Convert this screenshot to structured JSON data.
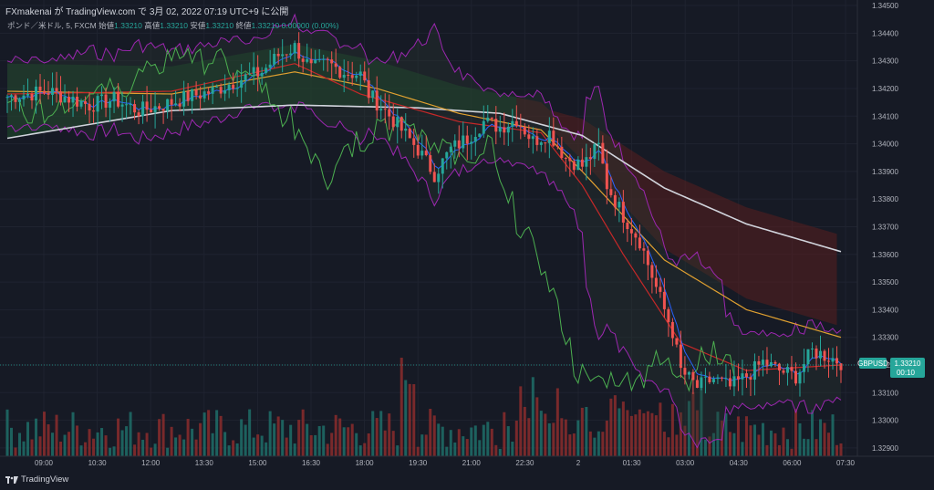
{
  "header": {
    "text": "FXmakenai が TradingView.com で 3月 02, 2022 07:19 UTC+9 に公開"
  },
  "legend": {
    "symbol": "ポンド／米ドル, 5, FXCM",
    "open_label": "始値",
    "open_value": "1.33210",
    "high_label": "高値",
    "high_value": "1.33210",
    "low_label": "安値",
    "low_value": "1.33210",
    "close_label": "終値",
    "close_value": "1.33210",
    "change": "0.00000 (0.00%)"
  },
  "brand": {
    "text": "TradingView",
    "logo": "tradingview-logo"
  },
  "price_tag": {
    "label": "GBPUSD",
    "price": "1.33210",
    "countdown": "00:10",
    "color": "#26a69a"
  },
  "colors": {
    "up": "#26a69a",
    "down": "#ef5350",
    "background": "#161a25",
    "ma_white": "#d1d4dc",
    "ma_orange": "#e0a030",
    "ma_red": "#c62828",
    "ma_blue": "#2962ff",
    "bb_purple": "#9c27b0",
    "lagging_green": "#4caf50",
    "cloud_green": "#1e4d2b",
    "cloud_red": "#5a1f1f"
  },
  "chart_data": {
    "type": "candlestick",
    "symbol": "GBPUSD",
    "timeframe": "5",
    "ylim": [
      1.3287,
      1.3452
    ],
    "y_ticks": [
      1.329,
      1.33,
      1.331,
      1.332,
      1.333,
      1.334,
      1.335,
      1.336,
      1.337,
      1.338,
      1.339,
      1.34,
      1.341,
      1.342,
      1.343,
      1.344,
      1.345
    ],
    "y_tick_labels": [
      "1.32900",
      "1.33000",
      "1.33100",
      "1.33200",
      "1.33300",
      "1.33400",
      "1.33500",
      "1.33600",
      "1.33700",
      "1.33800",
      "1.33900",
      "1.34000",
      "1.34100",
      "1.34200",
      "1.34300",
      "1.34400",
      "1.34500"
    ],
    "x_tick_labels": [
      "09:00",
      "10:30",
      "12:00",
      "13:30",
      "15:00",
      "16:30",
      "18:00",
      "19:30",
      "21:00",
      "22:30",
      "2",
      "01:30",
      "03:00",
      "04:30",
      "06:00",
      "07:30"
    ],
    "close_path": [
      [
        0,
        1.3417
      ],
      [
        5,
        1.3418
      ],
      [
        10,
        1.3419
      ],
      [
        14,
        1.3417
      ],
      [
        20,
        1.3414
      ],
      [
        26,
        1.3416
      ],
      [
        32,
        1.3412
      ],
      [
        38,
        1.3414
      ],
      [
        44,
        1.3417
      ],
      [
        50,
        1.3419
      ],
      [
        56,
        1.3423
      ],
      [
        62,
        1.3426
      ],
      [
        66,
        1.3432
      ],
      [
        70,
        1.3435
      ],
      [
        74,
        1.3427
      ],
      [
        78,
        1.3429
      ],
      [
        82,
        1.3426
      ],
      [
        86,
        1.3425
      ],
      [
        88,
        1.3418
      ],
      [
        92,
        1.3412
      ],
      [
        96,
        1.3405
      ],
      [
        100,
        1.3398
      ],
      [
        104,
        1.3389
      ],
      [
        108,
        1.3398
      ],
      [
        112,
        1.3402
      ],
      [
        116,
        1.3408
      ],
      [
        120,
        1.3406
      ],
      [
        124,
        1.3409
      ],
      [
        128,
        1.3401
      ],
      [
        132,
        1.3404
      ],
      [
        136,
        1.3395
      ],
      [
        140,
        1.3392
      ],
      [
        144,
        1.3399
      ],
      [
        146,
        1.3385
      ],
      [
        150,
        1.3374
      ],
      [
        154,
        1.3365
      ],
      [
        158,
        1.3348
      ],
      [
        162,
        1.3332
      ],
      [
        164,
        1.3318
      ],
      [
        168,
        1.3312
      ],
      [
        172,
        1.3315
      ],
      [
        176,
        1.3312
      ],
      [
        180,
        1.3316
      ],
      [
        184,
        1.3321
      ],
      [
        188,
        1.3318
      ],
      [
        192,
        1.3316
      ],
      [
        196,
        1.3325
      ],
      [
        200,
        1.3323
      ],
      [
        203,
        1.3321
      ]
    ],
    "indicators": {
      "ma_white_long": [
        [
          0,
          1.3402
        ],
        [
          40,
          1.3412
        ],
        [
          70,
          1.3414
        ],
        [
          100,
          1.3413
        ],
        [
          120,
          1.3411
        ],
        [
          140,
          1.3403
        ],
        [
          160,
          1.3384
        ],
        [
          180,
          1.3371
        ],
        [
          203,
          1.3361
        ]
      ],
      "ma_orange": [
        [
          0,
          1.3419
        ],
        [
          40,
          1.3418
        ],
        [
          70,
          1.3426
        ],
        [
          90,
          1.342
        ],
        [
          110,
          1.3411
        ],
        [
          130,
          1.3405
        ],
        [
          140,
          1.339
        ],
        [
          160,
          1.3358
        ],
        [
          180,
          1.334
        ],
        [
          203,
          1.333
        ]
      ],
      "ma_red": [
        [
          0,
          1.3418
        ],
        [
          40,
          1.3419
        ],
        [
          70,
          1.3429
        ],
        [
          86,
          1.3418
        ],
        [
          110,
          1.3408
        ],
        [
          130,
          1.3404
        ],
        [
          140,
          1.3385
        ],
        [
          150,
          1.336
        ],
        [
          164,
          1.3328
        ],
        [
          180,
          1.3318
        ],
        [
          203,
          1.332
        ]
      ]
    },
    "volume": {
      "unit": "ticks",
      "max": 100
    }
  }
}
